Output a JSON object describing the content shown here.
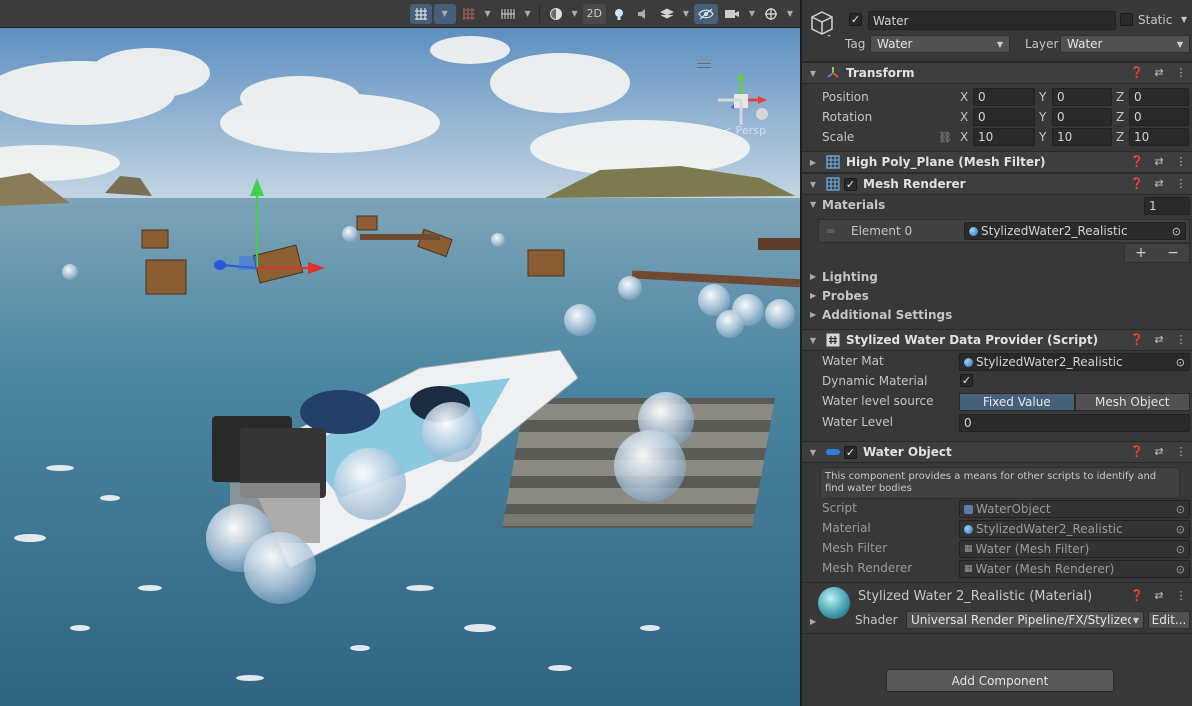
{
  "toolbar": {
    "mode_2d": "2D"
  },
  "scene": {
    "projection_label": "< Persp"
  },
  "inspector": {
    "object_name": "Water",
    "object_active": true,
    "static_label": "Static",
    "tag_label": "Tag",
    "tag_value": "Water",
    "layer_label": "Layer",
    "layer_value": "Water"
  },
  "transform": {
    "title": "Transform",
    "position_label": "Position",
    "rotation_label": "Rotation",
    "scale_label": "Scale",
    "axis_x": "X",
    "axis_y": "Y",
    "axis_z": "Z",
    "position": {
      "x": "0",
      "y": "0",
      "z": "0"
    },
    "rotation": {
      "x": "0",
      "y": "0",
      "z": "0"
    },
    "scale": {
      "x": "10",
      "y": "10",
      "z": "10"
    }
  },
  "mesh_filter": {
    "title": "High Poly_Plane (Mesh Filter)"
  },
  "mesh_renderer": {
    "title": "Mesh Renderer",
    "materials_label": "Materials",
    "materials_count": "1",
    "element0_label": "Element 0",
    "element0_value": "StylizedWater2_Realistic",
    "add_symbol": "+",
    "remove_symbol": "−",
    "lighting_label": "Lighting",
    "probes_label": "Probes",
    "additional_label": "Additional Settings"
  },
  "data_provider": {
    "title": "Stylized Water Data Provider (Script)",
    "water_mat_label": "Water Mat",
    "water_mat_value": "StylizedWater2_Realistic",
    "dynamic_label": "Dynamic Material",
    "source_label": "Water level source",
    "source_option_fixed": "Fixed Value",
    "source_option_mesh": "Mesh Object",
    "level_label": "Water Level",
    "level_value": "0"
  },
  "water_object": {
    "title": "Water Object",
    "help_text": "This component provides a means for other scripts to identify and find water bodies",
    "script_label": "Script",
    "script_value": "WaterObject",
    "material_label": "Material",
    "material_value": "StylizedWater2_Realistic",
    "mesh_filter_label": "Mesh Filter",
    "mesh_filter_value": "Water (Mesh Filter)",
    "mesh_renderer_label": "Mesh Renderer",
    "mesh_renderer_value": "Water (Mesh Renderer)"
  },
  "material_block": {
    "title": "Stylized Water 2_Realistic (Material)",
    "shader_label": "Shader",
    "shader_value": "Universal Render Pipeline/FX/Stylized Wa",
    "edit_label": "Edit..."
  },
  "add_component_label": "Add Component",
  "colors": {
    "accent_selected": "#46607c",
    "panel_bg": "#383838",
    "sky": "#8fb6d8",
    "water": "#3f7690"
  }
}
